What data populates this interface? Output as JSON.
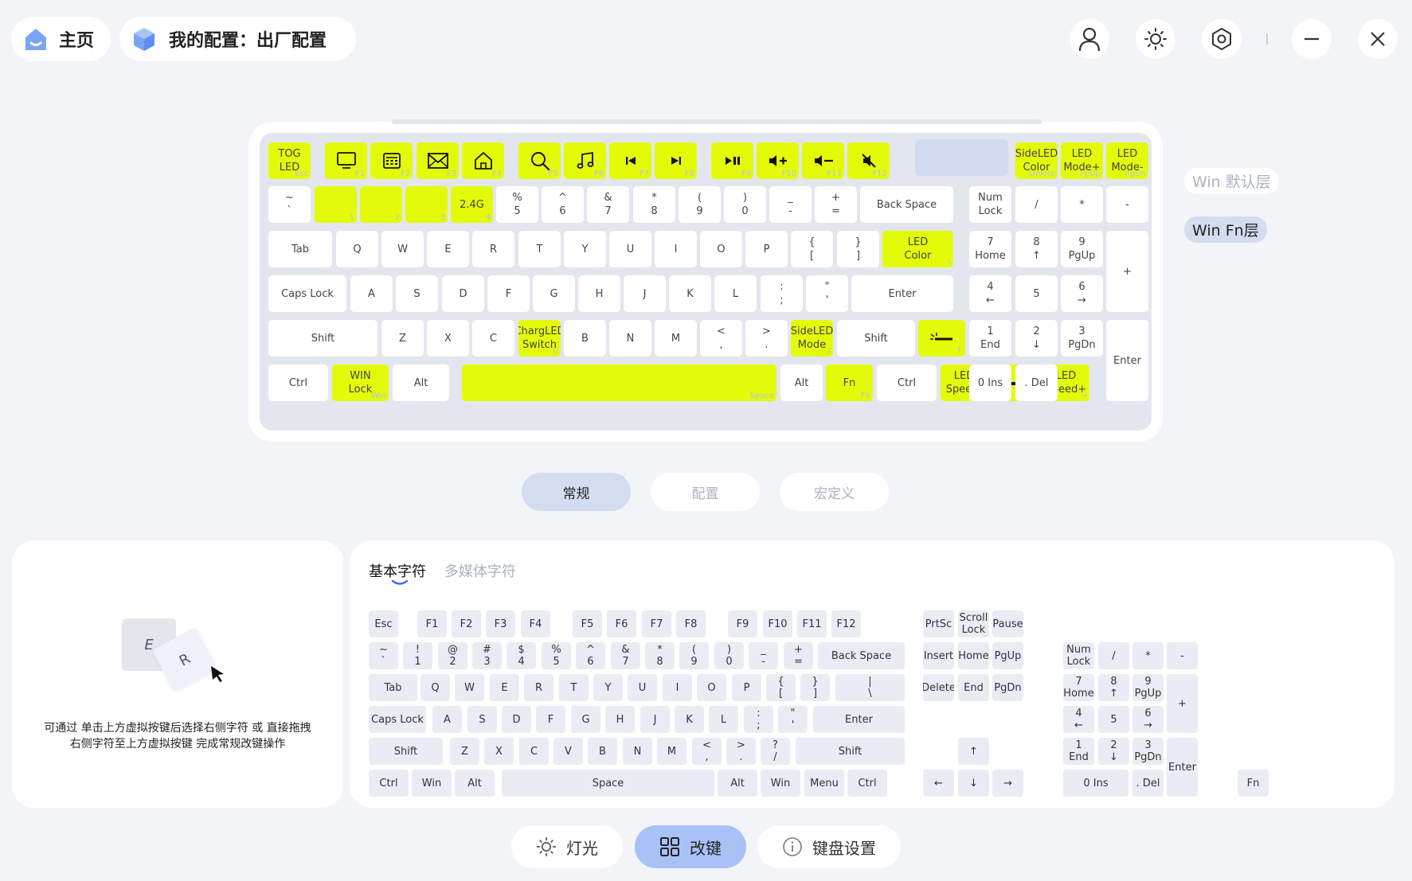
{
  "header": {
    "home_label": "主页",
    "config_label": "我的配置：出厂配置"
  },
  "keyboard": {
    "keys": [
      {
        "label": "TOG\nLED",
        "sub": "Esc",
        "hl": true
      },
      {
        "icon": "monitor-icon",
        "sub": "F1",
        "hl": true
      },
      {
        "icon": "calculator-icon",
        "sub": "F2",
        "hl": true
      },
      {
        "icon": "mail-icon",
        "sub": "F3",
        "hl": true
      },
      {
        "icon": "home-icon",
        "sub": "F4",
        "hl": true
      },
      {
        "icon": "search-icon",
        "sub": "F5",
        "hl": true
      },
      {
        "icon": "music-icon",
        "sub": "F6",
        "hl": true
      },
      {
        "icon": "prev-track-icon",
        "sub": "F7",
        "hl": true
      },
      {
        "icon": "next-track-icon",
        "sub": "F8",
        "hl": true
      },
      {
        "icon": "play-pause-icon",
        "sub": "F9",
        "hl": true
      },
      {
        "icon": "volume-up-icon",
        "sub": "F10",
        "hl": true
      },
      {
        "icon": "volume-down-icon",
        "sub": "F11",
        "hl": true
      },
      {
        "icon": "mute-icon",
        "sub": "F12",
        "hl": true
      },
      {
        "label": "",
        "sub": "",
        "blank": true
      },
      {
        "label": "SideLED\nColor",
        "sub": "Delete",
        "hl": true
      },
      {
        "label": "LED\nMode+",
        "sub": "PgUp",
        "hl": true
      },
      {
        "label": "LED\nMode-",
        "sub": "PgDn",
        "hl": true
      },
      {
        "label": "~\n`"
      },
      {
        "label": "",
        "sub": "1",
        "hl": true
      },
      {
        "label": "",
        "sub": "2",
        "hl": true
      },
      {
        "label": "",
        "sub": "3",
        "hl": true
      },
      {
        "label": "2.4G",
        "sub": "4",
        "hl": true
      },
      {
        "label": "%\n5"
      },
      {
        "label": "^\n6"
      },
      {
        "label": "&\n7"
      },
      {
        "label": "*\n8"
      },
      {
        "label": "(\n9"
      },
      {
        "label": ")\n0"
      },
      {
        "label": "_\n-"
      },
      {
        "label": "+\n="
      },
      {
        "label": "Back Space"
      },
      {
        "label": "Num\nLock"
      },
      {
        "label": "/"
      },
      {
        "label": "*"
      },
      {
        "label": "-"
      },
      {
        "label": "Tab"
      },
      {
        "label": "Q"
      },
      {
        "label": "W"
      },
      {
        "label": "E"
      },
      {
        "label": "R"
      },
      {
        "label": "T"
      },
      {
        "label": "Y"
      },
      {
        "label": "U"
      },
      {
        "label": "I"
      },
      {
        "label": "O"
      },
      {
        "label": "P"
      },
      {
        "label": "{\n["
      },
      {
        "label": "}\n]"
      },
      {
        "label": "LED\nColor",
        "sub": "\\",
        "hl": true
      },
      {
        "label": "7\nHome"
      },
      {
        "label": "8\n↑"
      },
      {
        "label": "9\nPgUp"
      },
      {
        "label": "+"
      },
      {
        "label": "Caps Lock"
      },
      {
        "label": "A"
      },
      {
        "label": "S"
      },
      {
        "label": "D"
      },
      {
        "label": "F"
      },
      {
        "label": "G"
      },
      {
        "label": "H"
      },
      {
        "label": "J"
      },
      {
        "label": "K"
      },
      {
        "label": "L"
      },
      {
        "label": ":\n;"
      },
      {
        "label": "\"\n'"
      },
      {
        "label": "Enter"
      },
      {
        "label": "4\n←"
      },
      {
        "label": "5"
      },
      {
        "label": "6\n→"
      },
      {
        "label": "Shift"
      },
      {
        "label": "Z"
      },
      {
        "label": "X"
      },
      {
        "label": "C"
      },
      {
        "label": "ChargLED\nSwitch",
        "sub": "V",
        "hl": true
      },
      {
        "label": "B"
      },
      {
        "label": "N"
      },
      {
        "label": "M"
      },
      {
        "label": "<\n,"
      },
      {
        "label": ">\n."
      },
      {
        "label": "SideLED\nMode",
        "sub": "/",
        "hl": true
      },
      {
        "label": "Shift"
      },
      {
        "icon": "brightness-up-icon",
        "sub": "↑",
        "hl": true
      },
      {
        "label": "1\nEnd"
      },
      {
        "label": "2\n↓"
      },
      {
        "label": "3\nPgDn"
      },
      {
        "label": "Enter"
      },
      {
        "label": "Ctrl"
      },
      {
        "label": "WIN\nLock",
        "sub": "Win",
        "hl": true
      },
      {
        "label": "Alt"
      },
      {
        "label": "",
        "sub": "Space",
        "hl": true
      },
      {
        "label": "Alt"
      },
      {
        "label": "Fn",
        "sub": "Fn",
        "hl": true
      },
      {
        "label": "Ctrl"
      },
      {
        "label": "LED\nSpeed-",
        "sub": "←",
        "hl": true
      },
      {
        "icon": "brightness-down-icon",
        "sub": "↓",
        "hl": true
      },
      {
        "label": "LED\nSpeed+",
        "sub": "→",
        "hl": true
      },
      {
        "label": "0 Ins"
      },
      {
        "label": ". Del"
      }
    ]
  },
  "layers": {
    "default": "Win 默认层",
    "fn": "Win Fn层"
  },
  "segments": {
    "general": "常规",
    "config": "配置",
    "macro": "宏定义"
  },
  "hint": {
    "key_e": "E",
    "key_r": "R",
    "line1": "可通过 单击上方虚拟按键后选择右侧字符 或 直接拖拽",
    "line2": "右侧字符至上方虚拟按键 完成常规改键操作"
  },
  "char_tabs": {
    "basic": "基本字符",
    "media": "多媒体字符"
  },
  "charset": {
    "keys": [
      "Esc",
      "F1",
      "F2",
      "F3",
      "F4",
      "F5",
      "F6",
      "F7",
      "F8",
      "F9",
      "F10",
      "F11",
      "F12",
      "PrtSc",
      "Scroll\nLock",
      "Pause",
      "~\n`",
      "!\n1",
      "@\n2",
      "#\n3",
      "$\n4",
      "%\n5",
      "^\n6",
      "&\n7",
      "*\n8",
      "(\n9",
      ")\n0",
      "_\n-",
      "+\n=",
      "Back Space",
      "Insert",
      "Home",
      "PgUp",
      "Num\nLock",
      "/",
      "*",
      "-",
      "Tab",
      "Q",
      "W",
      "E",
      "R",
      "T",
      "Y",
      "U",
      "I",
      "O",
      "P",
      "{\n[",
      "}\n]",
      "|\n\\",
      "Delete",
      "End",
      "PgDn",
      "7\nHome",
      "8\n↑",
      "9\nPgUp",
      "+",
      "Caps Lock",
      "A",
      "S",
      "D",
      "F",
      "G",
      "H",
      "J",
      "K",
      "L",
      ":\n;",
      "\"\n'",
      "Enter",
      "4\n←",
      "5",
      "6\n→",
      "Shift",
      "Z",
      "X",
      "C",
      "V",
      "B",
      "N",
      "M",
      "<\n,",
      ">\n.",
      "?\n/",
      "Shift",
      "↑",
      "1\nEnd",
      "2\n↓",
      "3\nPgDn",
      "Enter",
      "Ctrl",
      "Win",
      "Alt",
      "Space",
      "Alt",
      "Win",
      "Menu",
      "Ctrl",
      "←",
      "↓",
      "→",
      "0 Ins",
      ". Del",
      "Fn"
    ]
  },
  "bottom_nav": {
    "light": "灯光",
    "remap": "改键",
    "settings": "键盘设置"
  },
  "colors": {
    "accent": "#e3fb08",
    "active": "#a8c1f7",
    "segment_active": "#d4dcf0"
  }
}
